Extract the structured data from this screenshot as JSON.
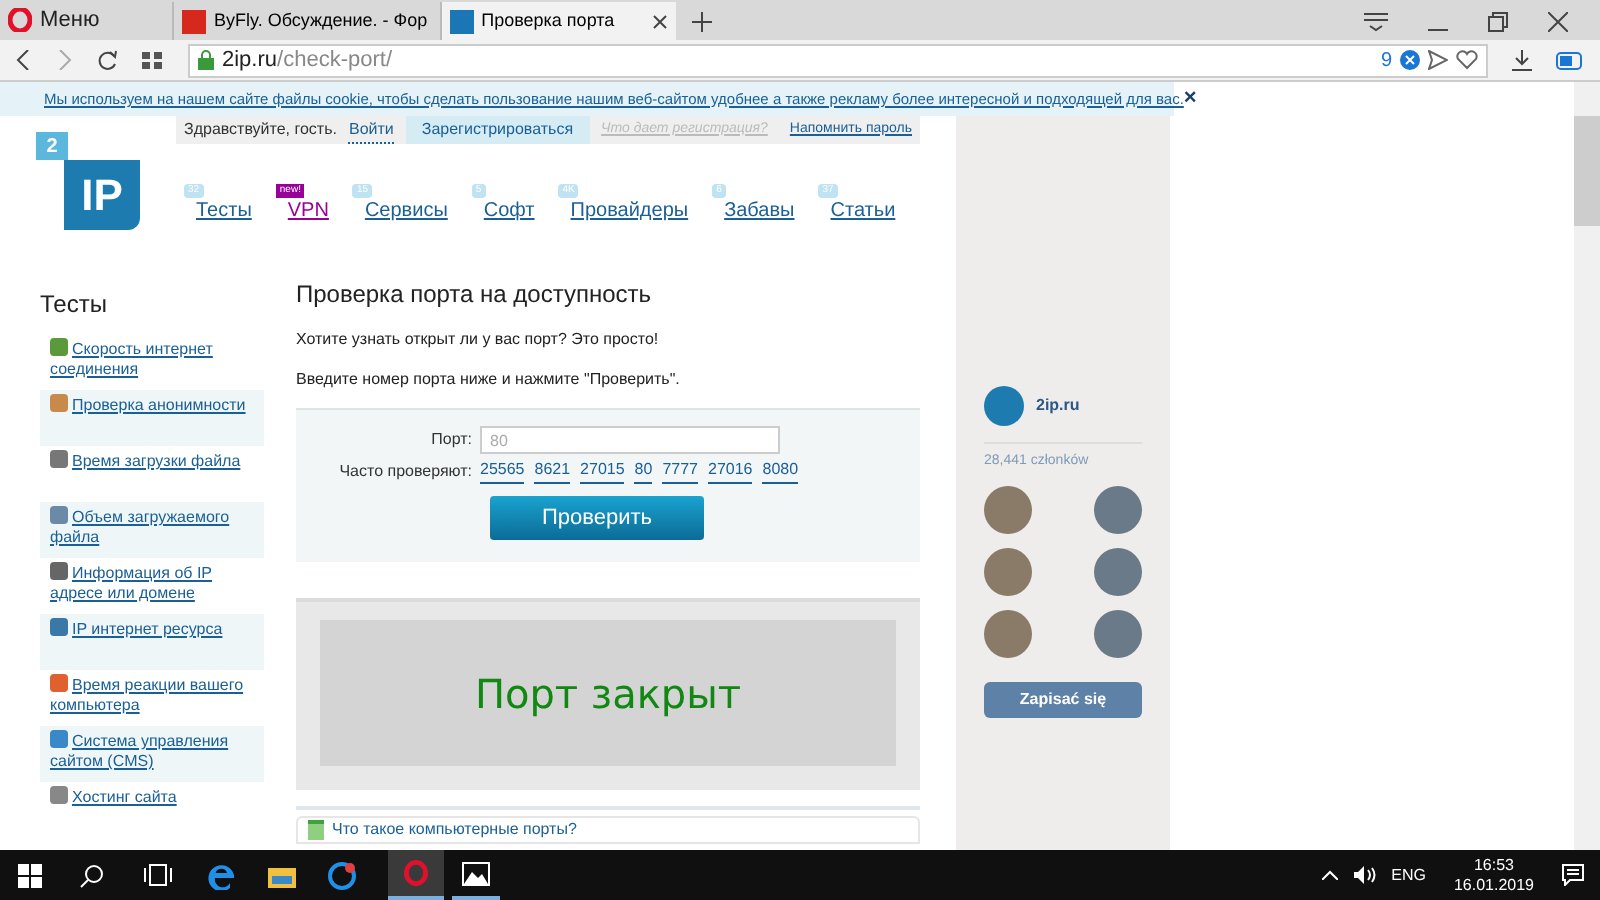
{
  "browser": {
    "menu_label": "Меню",
    "tabs": [
      {
        "title": "ByFly. Обсуждение. - Фор",
        "selected": false
      },
      {
        "title": "Проверка порта",
        "selected": true
      }
    ],
    "url_host": "2ip.ru",
    "url_path": "/check-port/",
    "blocked_count": "9"
  },
  "cookie_notice": "Мы используем на нашем сайте файлы cookie, чтобы сделать пользование нашим веб-сайтом удобнее а также рекламу более интересной и подходящей для вас.",
  "close_symbol": "×",
  "account_bar": {
    "greeting": "Здравствуйте, гость.",
    "login": "Войти",
    "register": "Зарегистрироваться",
    "why_register": "Что дает регистрация?",
    "remind": "Напомнить пароль"
  },
  "logo": {
    "badge": "2",
    "text": "IP"
  },
  "nav": [
    {
      "label": "Тесты",
      "badge": "32",
      "kind": "count"
    },
    {
      "label": "VPN",
      "badge": "new!",
      "kind": "new"
    },
    {
      "label": "Сервисы",
      "badge": "15",
      "kind": "count"
    },
    {
      "label": "Софт",
      "badge": "5",
      "kind": "count"
    },
    {
      "label": "Провайдеры",
      "badge": "4K",
      "kind": "count"
    },
    {
      "label": "Забавы",
      "badge": "6",
      "kind": "count"
    },
    {
      "label": "Статьи",
      "badge": "37",
      "kind": "count"
    }
  ],
  "sidebar": {
    "title": "Тесты",
    "items": [
      {
        "label": "Скорость интернет соединения",
        "color": "#5a9a3a"
      },
      {
        "label": "Проверка анонимности",
        "color": "#c88a4a"
      },
      {
        "label": "Время загрузки файла",
        "color": "#777777"
      },
      {
        "label": "Объем загружаемого файла",
        "color": "#6a8aa8"
      },
      {
        "label": "Информация об IP адресе или домене",
        "color": "#666666"
      },
      {
        "label": "IP интернет ресурса",
        "color": "#3a78a8"
      },
      {
        "label": "Время реакции вашего компьютера",
        "color": "#e06030"
      },
      {
        "label": "Система управления сайтом (CMS)",
        "color": "#3a88c8"
      },
      {
        "label": "Хостинг сайта",
        "color": "#888888"
      }
    ]
  },
  "main": {
    "title": "Проверка порта на доступность",
    "intro": "Хотите узнать открыт ли у вас порт? Это просто!",
    "instruction": "Введите номер порта ниже и нажмите \"Проверить\".",
    "form": {
      "port_label": "Порт:",
      "port_placeholder": "80",
      "frequent_label": "Часто проверяют:",
      "frequent_ports": [
        "25565",
        "8621",
        "27015",
        "80",
        "7777",
        "27016",
        "8080"
      ],
      "submit": "Проверить"
    },
    "result": "Порт закрыт",
    "faq_link": "Что такое компьютерные порты?"
  },
  "vk_widget": {
    "name": "2ip.ru",
    "members": "28,441 członków",
    "join": "Zapisać się"
  },
  "taskbar": {
    "language": "ENG",
    "time": "16:53",
    "date": "16.01.2019"
  }
}
